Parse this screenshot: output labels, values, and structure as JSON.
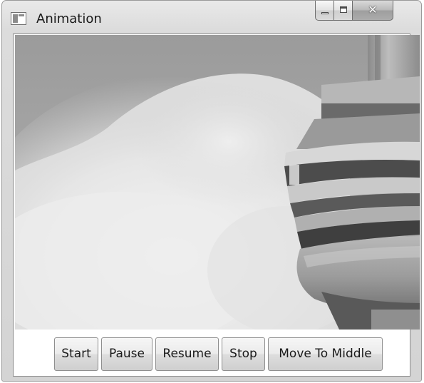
{
  "window": {
    "title": "Animation",
    "icon": "window-app-icon",
    "caption_buttons": [
      "minimize-icon",
      "maximize-icon",
      "close-icon"
    ]
  },
  "content": {
    "image": "photo of a tower observation deck against a cloudy sky"
  },
  "buttons": {
    "start": "Start",
    "pause": "Pause",
    "resume": "Resume",
    "stop": "Stop",
    "move_to_middle": "Move To Middle"
  },
  "colors": {
    "close_button": "#a8a8a8",
    "window_frame": "#dcdcdc",
    "button_face": "#e6e6e6"
  }
}
